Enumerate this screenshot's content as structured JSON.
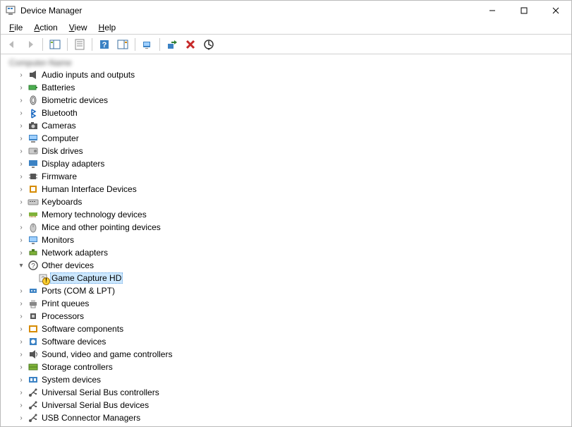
{
  "window": {
    "title": "Device Manager"
  },
  "menus": {
    "file": "File",
    "action": "Action",
    "view": "View",
    "help": "Help"
  },
  "toolbar": {
    "back": "Back",
    "forward": "Forward",
    "show_hide_tree": "Show/Hide Console Tree",
    "properties": "Properties",
    "help": "Help",
    "show_hide_action": "Show/Hide Action Pane",
    "scan": "Scan for hardware changes",
    "update": "Update device driver",
    "uninstall": "Uninstall device",
    "disable": "Disable device"
  },
  "tree": {
    "root": "Computer-Name",
    "items": [
      {
        "label": "Audio inputs and outputs",
        "icon": "speaker"
      },
      {
        "label": "Batteries",
        "icon": "battery"
      },
      {
        "label": "Biometric devices",
        "icon": "finger"
      },
      {
        "label": "Bluetooth",
        "icon": "bt"
      },
      {
        "label": "Cameras",
        "icon": "camera"
      },
      {
        "label": "Computer",
        "icon": "pc"
      },
      {
        "label": "Disk drives",
        "icon": "disk"
      },
      {
        "label": "Display adapters",
        "icon": "display"
      },
      {
        "label": "Firmware",
        "icon": "chip"
      },
      {
        "label": "Human Interface Devices",
        "icon": "hid"
      },
      {
        "label": "Keyboards",
        "icon": "kbd"
      },
      {
        "label": "Memory technology devices",
        "icon": "mem"
      },
      {
        "label": "Mice and other pointing devices",
        "icon": "mouse"
      },
      {
        "label": "Monitors",
        "icon": "monitor"
      },
      {
        "label": "Network adapters",
        "icon": "net"
      },
      {
        "label": "Other devices",
        "icon": "other",
        "expanded": true,
        "children": [
          {
            "label": "Game Capture HD",
            "icon": "unknown",
            "selected": true,
            "warn": true
          }
        ]
      },
      {
        "label": "Ports (COM & LPT)",
        "icon": "port"
      },
      {
        "label": "Print queues",
        "icon": "print"
      },
      {
        "label": "Processors",
        "icon": "cpu"
      },
      {
        "label": "Software components",
        "icon": "swc"
      },
      {
        "label": "Software devices",
        "icon": "swd"
      },
      {
        "label": "Sound, video and game controllers",
        "icon": "sound"
      },
      {
        "label": "Storage controllers",
        "icon": "storage"
      },
      {
        "label": "System devices",
        "icon": "sys"
      },
      {
        "label": "Universal Serial Bus controllers",
        "icon": "usb"
      },
      {
        "label": "Universal Serial Bus devices",
        "icon": "usb"
      },
      {
        "label": "USB Connector Managers",
        "icon": "usb"
      }
    ]
  }
}
